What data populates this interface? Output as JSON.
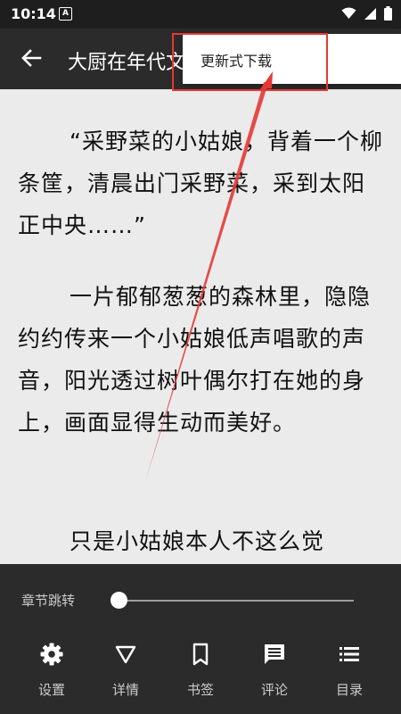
{
  "status_bar": {
    "time": "10:14",
    "notification_badge": "A",
    "icons": [
      "wifi-icon",
      "signal-icon",
      "battery-icon"
    ]
  },
  "app_bar": {
    "title": "大厨在年代文",
    "back_icon": "arrow-left-icon"
  },
  "menu": {
    "items": [
      {
        "label": "更新式下载"
      }
    ]
  },
  "content": {
    "paragraphs": [
      "“采野菜的小姑娘，背着一个柳条筐，清晨出门采野菜，采到太阳正中央……”",
      "一片郁郁葱葱的森林里，隐隐约约传来一个小姑娘低声唱歌的声音，阳光透过树叶偶尔打在她的身上，画面显得生动而美好。",
      "只是小姑娘本人不这么觉"
    ]
  },
  "bottom_panel": {
    "chapter_jump_label": "章节跳转",
    "chapter_progress": 0.0,
    "nav": [
      {
        "label": "设置",
        "icon": "gear-icon"
      },
      {
        "label": "详情",
        "icon": "triangle-down-icon"
      },
      {
        "label": "书签",
        "icon": "bookmark-icon"
      },
      {
        "label": "评论",
        "icon": "comment-icon"
      },
      {
        "label": "目录",
        "icon": "list-icon"
      }
    ]
  },
  "colors": {
    "app_bar": "#2b2b2b",
    "reader_bg": "#ebebeb",
    "highlight": "#e53935"
  }
}
